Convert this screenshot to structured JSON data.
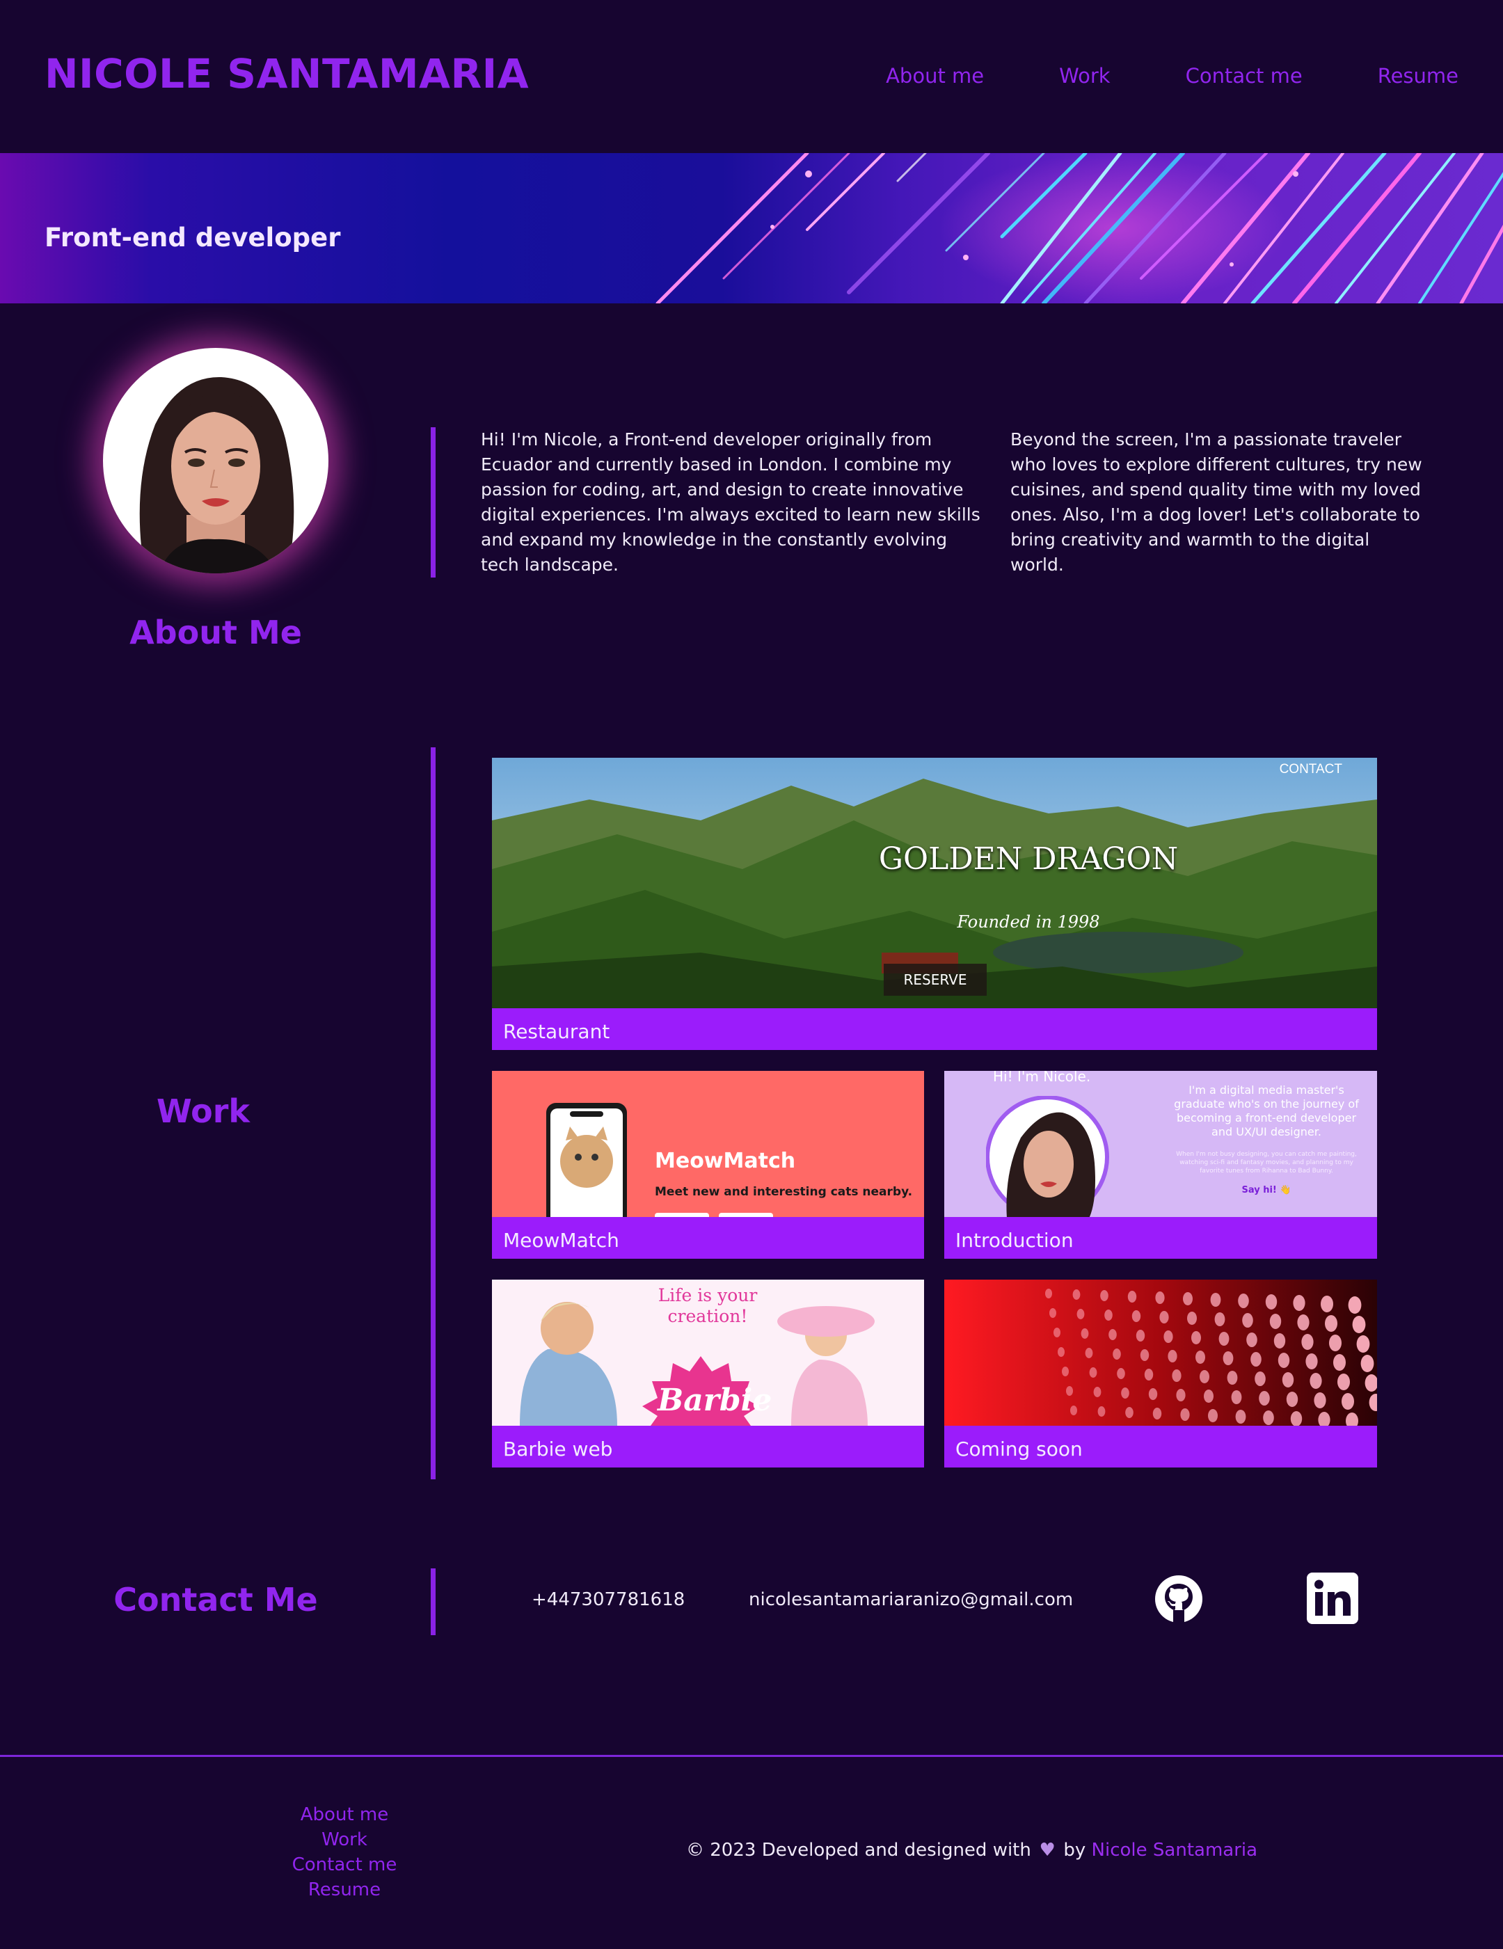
{
  "header": {
    "name": "NICOLE SANTAMARIA",
    "nav": [
      "About me",
      "Work",
      "Contact me",
      "Resume"
    ]
  },
  "banner": {
    "role": "Front-end developer"
  },
  "about": {
    "heading": "About Me",
    "paragraph_1": "Hi! I'm Nicole, a Front-end developer originally from Ecuador and currently based in London. I combine my passion for coding, art, and design to create innovative digital experiences. I'm always excited to learn new skills and expand my knowledge in the constantly evolving tech landscape.",
    "paragraph_2": "Beyond the screen, I'm a passionate traveler who loves to explore different cultures, try new cuisines, and spend quality time with my loved ones. Also, I'm a dog lover! Let's collaborate to bring creativity and warmth to the digital world."
  },
  "work": {
    "heading": "Work",
    "projects": [
      {
        "caption": "Restaurant",
        "thumb": {
          "corner": "CONTACT",
          "title": "GOLDEN DRAGON",
          "subtitle": "Founded in 1998",
          "button": "RESERVE"
        }
      },
      {
        "caption": "MeowMatch",
        "thumb": {
          "title": "MeowMatch",
          "subtitle": "Meet new and interesting cats nearby."
        }
      },
      {
        "caption": "Introduction",
        "thumb": {
          "greeting": "Hi! I'm Nicole.",
          "blurb": "I'm a digital media master's graduate who's on the journey of becoming a front-end developer and UX/UI designer.",
          "small": "When I'm not busy designing, you can catch me painting, watching sci-fi and fantasy movies, and planning to my favorite tunes from Rihanna to Bad Bunny.",
          "cta": "Say hi! 👋"
        }
      },
      {
        "caption": "Barbie web",
        "thumb": {
          "tagline": "Life is your creation!",
          "logo": "Barbie"
        }
      },
      {
        "caption": "Coming soon"
      }
    ]
  },
  "contact": {
    "heading": "Contact Me",
    "phone": "+447307781618",
    "email": "nicolesantamariaranizo@gmail.com",
    "icons": [
      "github-icon",
      "linkedin-icon"
    ]
  },
  "footer": {
    "nav": [
      "About me",
      "Work",
      "Contact me",
      "Resume"
    ],
    "copyright_prefix": "© 2023 Developed and designed with",
    "by": "by",
    "author": "Nicole Santamaria"
  },
  "colors": {
    "background": "#170530",
    "accent": "#9125ee",
    "card_caption": "#9b1cfb"
  }
}
